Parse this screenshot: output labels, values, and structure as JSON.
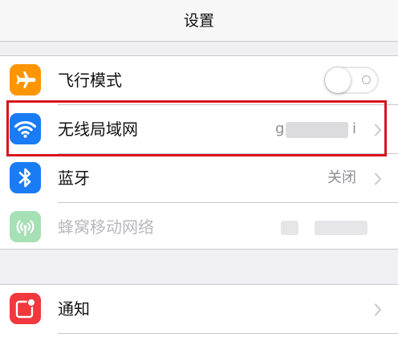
{
  "navbar": {
    "title": "设置"
  },
  "settings": {
    "airplane": {
      "label": "飞行模式",
      "toggle_state": "off",
      "icon": "airplane-icon",
      "icon_color": "#ff9500"
    },
    "wifi": {
      "label": "无线局域网",
      "value_start": "g",
      "value_end": "i",
      "icon": "wifi-icon",
      "icon_color": "#1a7cf5"
    },
    "bluetooth": {
      "label": "蓝牙",
      "value": "关闭",
      "icon": "bluetooth-icon",
      "icon_color": "#1a7cf5"
    },
    "cellular": {
      "label": "蜂窝移动网络",
      "icon": "cellular-antenna-icon",
      "icon_color": "#a6e0b5",
      "disabled": true
    },
    "notifications": {
      "label": "通知",
      "icon": "notifications-icon",
      "icon_color": "#f0383d"
    }
  },
  "highlight_color": "#d8141d"
}
